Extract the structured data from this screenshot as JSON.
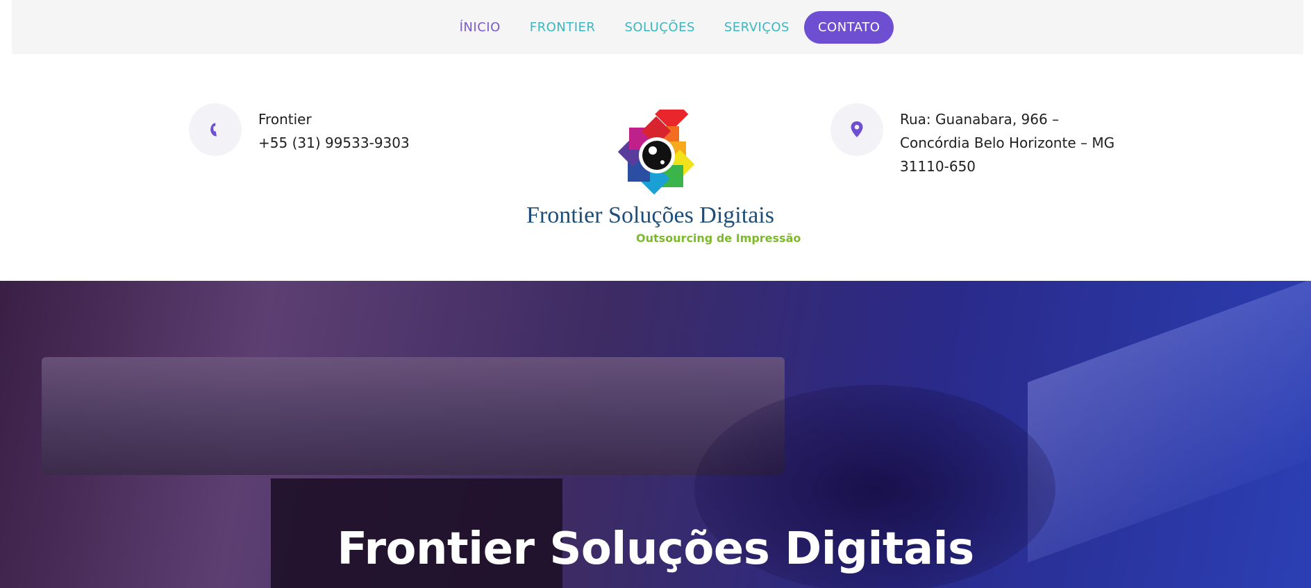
{
  "nav": {
    "items": [
      {
        "label": "ÍNICIO"
      },
      {
        "label": "FRONTIER"
      },
      {
        "label": "SOLUÇÕES"
      },
      {
        "label": "SERVIÇOS"
      }
    ],
    "cta_label": "CONTATO"
  },
  "contact_phone": {
    "icon": "phone-icon",
    "name": "Frontier",
    "phone": "+55 (31) 99533-9303"
  },
  "contact_address": {
    "icon": "map-pin-icon",
    "line1": "Rua: Guanabara, 966 –",
    "line2": "Concórdia Belo Horizonte – MG",
    "line3": "31110-650"
  },
  "logo": {
    "name": "Frontier Soluções Digitais",
    "tagline": "Outsourcing de Impressão"
  },
  "hero": {
    "title": "Frontier Soluções Digitais"
  },
  "colors": {
    "accent": "#6e4fd1",
    "nav_link": "#3bb7bf",
    "nav_active": "#7a5bc7",
    "logo_blue": "#1d4e7a",
    "logo_green": "#7dba2a"
  }
}
